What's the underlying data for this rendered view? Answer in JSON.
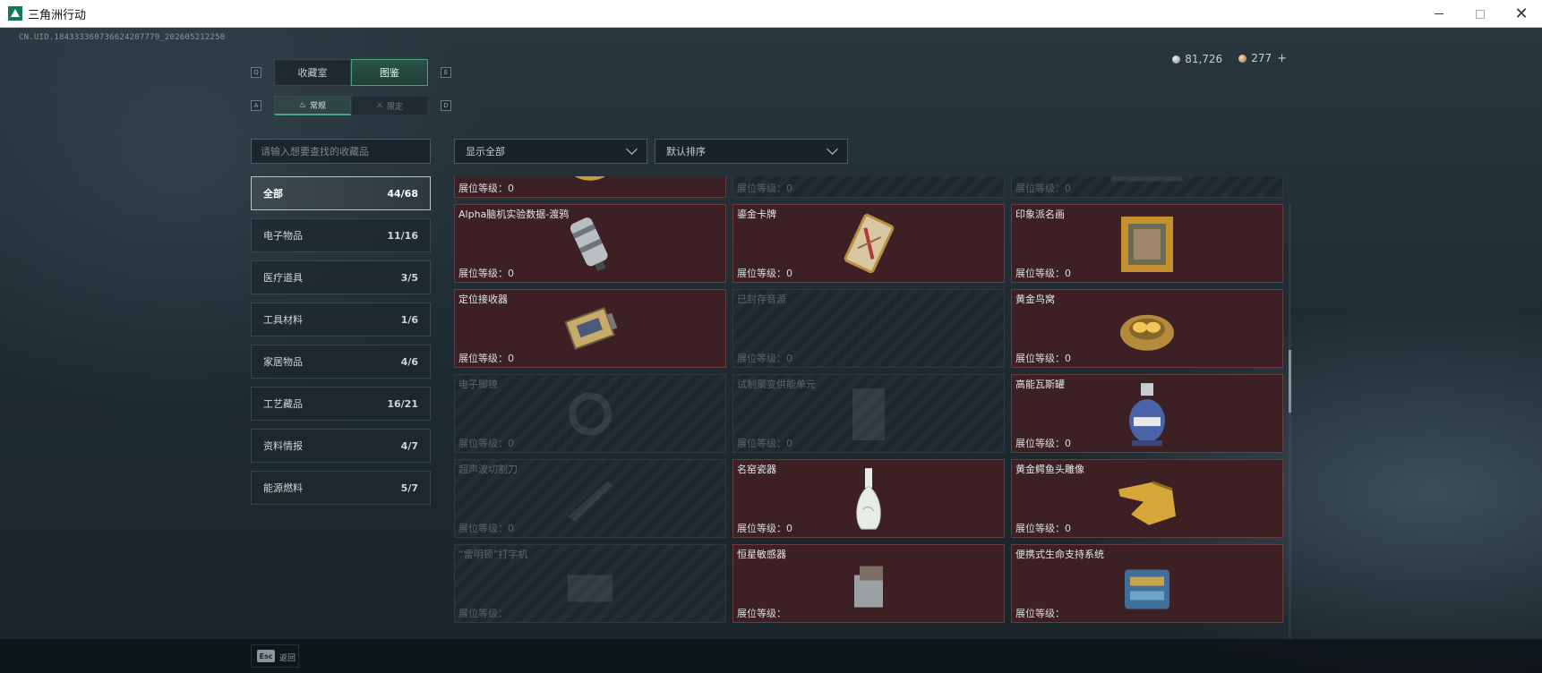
{
  "window": {
    "title": "三角洲行动",
    "controls": [
      "minimize",
      "maximize",
      "close"
    ]
  },
  "uid": "CN.UID.184333360736624207779_202605212250",
  "currency": {
    "silver": "81,726",
    "gold": "277",
    "add": "+"
  },
  "tabs": [
    {
      "label": "收藏室",
      "key": "Q",
      "active": false
    },
    {
      "label": "图鉴",
      "key": "E",
      "active": true
    }
  ],
  "subtabs": [
    {
      "label": "常规",
      "key": "A",
      "icon": "flame-icon",
      "active": true
    },
    {
      "label": "限定",
      "key": "D",
      "icon": "crossed-swords-icon",
      "active": false
    }
  ],
  "search": {
    "placeholder": "请输入想要查找的收藏品"
  },
  "categories": [
    {
      "label": "全部",
      "count": "44/68",
      "active": true
    },
    {
      "label": "电子物品",
      "count": "11/16"
    },
    {
      "label": "医疗道具",
      "count": "3/5"
    },
    {
      "label": "工具材料",
      "count": "1/6"
    },
    {
      "label": "家居物品",
      "count": "4/6"
    },
    {
      "label": "工艺藏品",
      "count": "16/21"
    },
    {
      "label": "资料情报",
      "count": "4/7"
    },
    {
      "label": "能源燃料",
      "count": "5/7"
    }
  ],
  "filters": {
    "display": "显示全部",
    "sort": "默认排序"
  },
  "level_label": "展位等级：",
  "items": [
    {
      "name": "",
      "level": "0",
      "owned": true,
      "art": "gold-watch"
    },
    {
      "name": "",
      "level": "0",
      "owned": false,
      "art": "none"
    },
    {
      "name": "",
      "level": "0",
      "owned": false,
      "art": "crate"
    },
    {
      "name": "Alpha脑机实验数据-渡鸦",
      "level": "0",
      "owned": true,
      "art": "data-cylinder"
    },
    {
      "name": "鎏金卡牌",
      "level": "0",
      "owned": true,
      "art": "gilded-card"
    },
    {
      "name": "印象派名画",
      "level": "0",
      "owned": true,
      "art": "painting"
    },
    {
      "name": "定位接收器",
      "level": "0",
      "owned": true,
      "art": "receiver"
    },
    {
      "name": "已封存音源",
      "level": "0",
      "owned": false,
      "art": "none"
    },
    {
      "name": "黄金鸟窝",
      "level": "0",
      "owned": true,
      "art": "golden-nest"
    },
    {
      "name": "电子脚镣",
      "level": "0",
      "owned": false,
      "art": "shackle"
    },
    {
      "name": "试制聚变供能单元",
      "level": "0",
      "owned": false,
      "art": "fusion-unit"
    },
    {
      "name": "高能瓦斯罐",
      "level": "0",
      "owned": true,
      "art": "gas-canister"
    },
    {
      "name": "超声波切割刀",
      "level": "0",
      "owned": false,
      "art": "knife"
    },
    {
      "name": "名窑瓷器",
      "level": "0",
      "owned": true,
      "art": "porcelain-vase"
    },
    {
      "name": "黄金鳄鱼头雕像",
      "level": "0",
      "owned": true,
      "art": "gold-croc"
    },
    {
      "name": "“雷明顿”打字机",
      "level": "",
      "owned": false,
      "art": "typewriter"
    },
    {
      "name": "恒星敏感器",
      "level": "",
      "owned": true,
      "art": "star-sensor"
    },
    {
      "name": "便携式生命支持系统",
      "level": "",
      "owned": true,
      "art": "life-support"
    }
  ],
  "footer": {
    "esc_key": "Esc",
    "esc_label": "返回"
  },
  "colors": {
    "accent": "#48a384",
    "owned_bg": "#3c2023",
    "locked_bg": "#232d33"
  }
}
